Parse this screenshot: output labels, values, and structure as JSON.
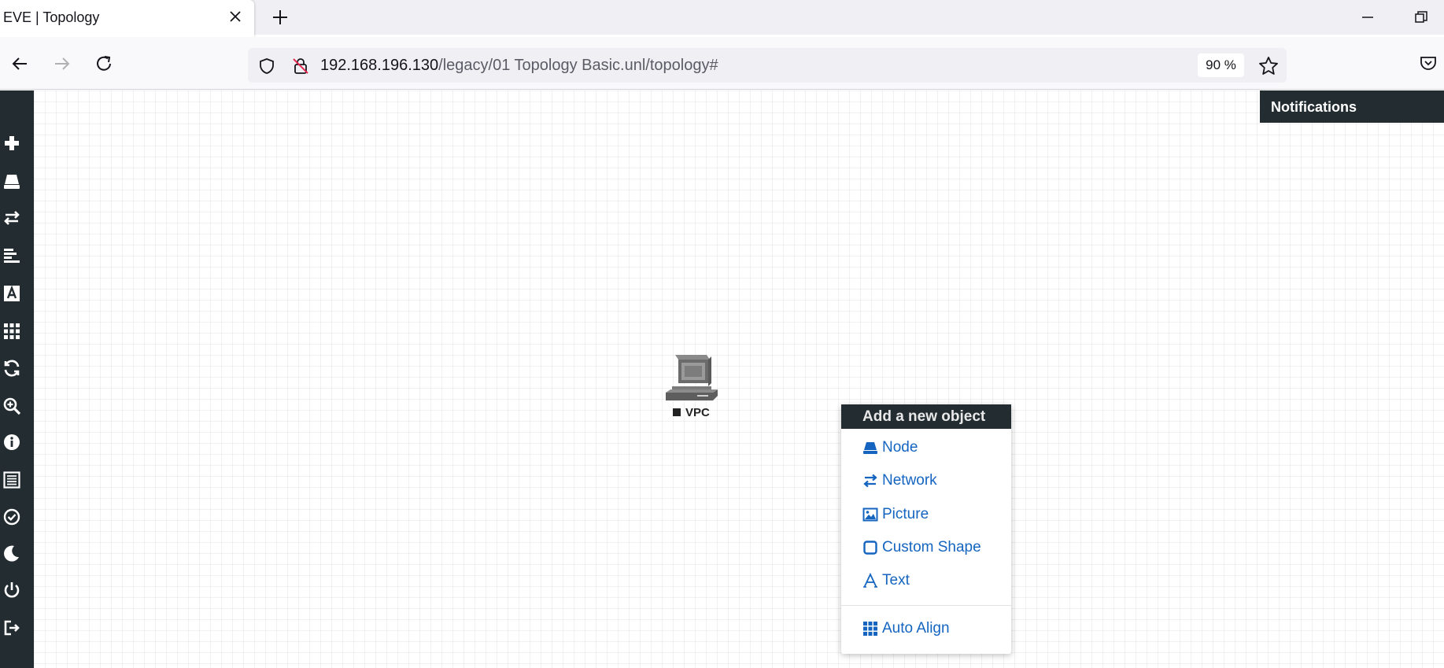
{
  "browser": {
    "tab_title": "EVE | Topology",
    "url_host": "192.168.196.130",
    "url_path": "/legacy/01  Topology  Basic.unl/topology#",
    "zoom": "90 %"
  },
  "sidebar": {
    "items": [
      {
        "icon": "plus-icon"
      },
      {
        "icon": "node-icon"
      },
      {
        "icon": "network-icon"
      },
      {
        "icon": "align-left-icon"
      },
      {
        "icon": "text-font-icon"
      },
      {
        "icon": "grid-icon"
      },
      {
        "icon": "refresh-icon"
      },
      {
        "icon": "zoom-in-icon"
      },
      {
        "icon": "info-icon"
      },
      {
        "icon": "list-icon"
      },
      {
        "icon": "check-circle-icon"
      },
      {
        "icon": "moon-icon"
      },
      {
        "icon": "power-icon"
      },
      {
        "icon": "sign-out-icon"
      }
    ]
  },
  "notifications": {
    "title": "Notifications"
  },
  "topology": {
    "nodes": [
      {
        "label": "VPC",
        "icon": "vpc-computer-icon"
      }
    ]
  },
  "context_menu": {
    "title": "Add a new object",
    "items": [
      {
        "label": "Node",
        "icon": "node-icon"
      },
      {
        "label": "Network",
        "icon": "network-icon"
      },
      {
        "label": "Picture",
        "icon": "picture-icon"
      },
      {
        "label": "Custom Shape",
        "icon": "square-icon"
      },
      {
        "label": "Text",
        "icon": "text-icon"
      }
    ],
    "secondary_items": [
      {
        "label": "Auto Align",
        "icon": "grid-icon"
      }
    ]
  },
  "colors": {
    "dark_panel": "#222c31",
    "link_blue": "#1565c0"
  }
}
